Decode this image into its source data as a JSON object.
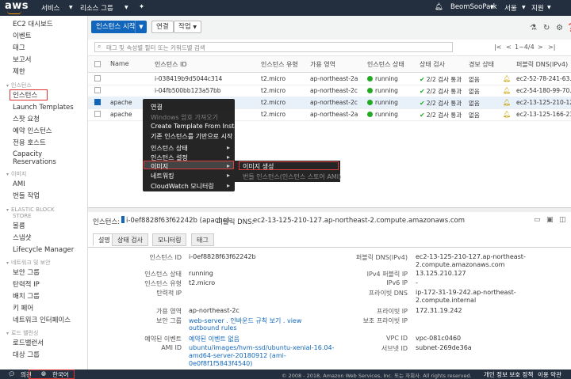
{
  "topbar": {
    "logo": "aws",
    "services": "서비스",
    "resource_groups": "리소스 그룹",
    "user": "BeomSooPark",
    "region": "서울",
    "support": "지원"
  },
  "sidebar": {
    "items_top": [
      "EC2 대시보드",
      "이벤트",
      "태그",
      "보고서",
      "제한"
    ],
    "sec_instances": "인스턴스",
    "items_instances": [
      "인스턴스",
      "Launch Templates",
      "스팟 요청",
      "예약 인스턴스",
      "전용 호스트",
      "Capacity",
      "Reservations"
    ],
    "sec_images": "이미지",
    "items_images": [
      "AMI",
      "번들 작업"
    ],
    "sec_ebs": [
      "ELASTIC BLOCK",
      "STORE"
    ],
    "items_ebs": [
      "볼륨",
      "스냅샷",
      "Lifecycle Manager"
    ],
    "sec_network": "네트워크 및 보안",
    "items_network": [
      "보안 그룹",
      "탄력적 IP",
      "배치 그룹",
      "키 페어",
      "네트워크 인터페이스"
    ],
    "sec_lb": "로드 밸런싱",
    "items_lb": [
      "로드밸런서",
      "대상 그룹"
    ]
  },
  "toolbar": {
    "launch": "인스턴스 시작",
    "connect": "연결",
    "actions": "작업"
  },
  "search": {
    "placeholder": "태그 및 속성별 필터 또는 키워드별 검색",
    "pager": "1~4/4"
  },
  "table": {
    "headers": [
      "Name",
      "인스턴스 ID",
      "인스턴스 유형",
      "가용 영역",
      "인스턴스 상태",
      "상태 검사",
      "경보 상태",
      "퍼블릭 DNS(IPv4)"
    ],
    "rows": [
      {
        "name": "",
        "id": "i-038419b9d5044c314",
        "type": "t2.micro",
        "az": "ap-northeast-2a",
        "state": "running",
        "check": "2/2 검사 통과",
        "alarm": "없음",
        "dns": "ec2-52-78-241-63.a"
      },
      {
        "name": "",
        "id": "i-04fb500bb123a57bb",
        "type": "t2.micro",
        "az": "ap-northeast-2c",
        "state": "running",
        "check": "2/2 검사 통과",
        "alarm": "없음",
        "dns": "ec2-54-180-99-70.a"
      },
      {
        "name": "apache",
        "id": "",
        "type": "t2.micro",
        "az": "ap-northeast-2c",
        "state": "running",
        "check": "2/2 검사 통과",
        "alarm": "없음",
        "dns": "ec2-13-125-210-127"
      },
      {
        "name": "apache",
        "id": "",
        "type": "t2.micro",
        "az": "ap-northeast-2a",
        "state": "running",
        "check": "2/2 검사 통과",
        "alarm": "없음",
        "dns": "ec2-13-125-166-232"
      }
    ]
  },
  "context_menu": {
    "items": [
      "연결",
      "Windows 암호 가져오기",
      "Create Template From Instance",
      "기존 인스턴스를 기반으로 시작",
      "인스턴스 상태",
      "인스턴스 설정",
      "이미지",
      "네트워킹",
      "CloudWatch 모니터링"
    ],
    "submenu": [
      "이미지 생성",
      "번들 인스턴스(인스턴스 스토어 AMI)"
    ]
  },
  "detail": {
    "instance_label": "인스턴스:",
    "instance_value": "i-0ef8828f63f62242b (apache)",
    "dns_label": "퍼블릭 DNS:",
    "dns_value": "ec2-13-125-210-127.ap-northeast-2.compute.amazonaws.com",
    "tabs": [
      "설명",
      "상태 검사",
      "모니터링",
      "태그"
    ],
    "left": [
      {
        "k": "인스턴스 ID",
        "v": "i-0ef8828f63f62242b"
      },
      {
        "k": "인스턴스 상태",
        "v": "running"
      },
      {
        "k": "인스턴스 유형",
        "v": "t2.micro"
      },
      {
        "k": "탄력적 IP",
        "v": ""
      },
      {
        "k": "가용 영역",
        "v": "ap-northeast-2c"
      },
      {
        "k": "보안 그룹",
        "v": "web-server . 인바운드 규칙 보기 . view"
      },
      {
        "k": "",
        "v": "outbound rules"
      },
      {
        "k": "예약된 이벤트",
        "v": "예약된 이벤트 없음"
      },
      {
        "k": "AMI ID",
        "v": "ubuntu/images/hvm-ssd/ubuntu-xenial-16.04-"
      },
      {
        "k": "",
        "v": "amd64-server-20180912 (ami-"
      },
      {
        "k": "",
        "v": "0e0f8f1f5843f4540)"
      }
    ],
    "right": [
      {
        "k": "퍼블릭 DNS(IPv4)",
        "v": "ec2-13-125-210-127.ap-northeast-"
      },
      {
        "k": "",
        "v": "2.compute.amazonaws.com"
      },
      {
        "k": "IPv4 퍼블릭 IP",
        "v": "13.125.210.127"
      },
      {
        "k": "IPv6 IP",
        "v": "-"
      },
      {
        "k": "프라이빗 DNS",
        "v": "ip-172-31-19-242.ap-northeast-"
      },
      {
        "k": "",
        "v": "2.compute.internal"
      },
      {
        "k": "프라이빗 IP",
        "v": "172.31.19.242"
      },
      {
        "k": "보조 프라이빗 IP",
        "v": ""
      },
      {
        "k": "VPC ID",
        "v": "vpc-081c0460"
      },
      {
        "k": "서브넷 ID",
        "v": "subnet-269de36a"
      }
    ]
  },
  "footer": {
    "feedback": "의견",
    "language": "한국어",
    "copyright": "© 2008 - 2018, Amazon Web Services, Inc. 또는 자회사. All rights reserved.",
    "privacy": "개인 정보 보호 정책",
    "terms": "이용 약관"
  }
}
